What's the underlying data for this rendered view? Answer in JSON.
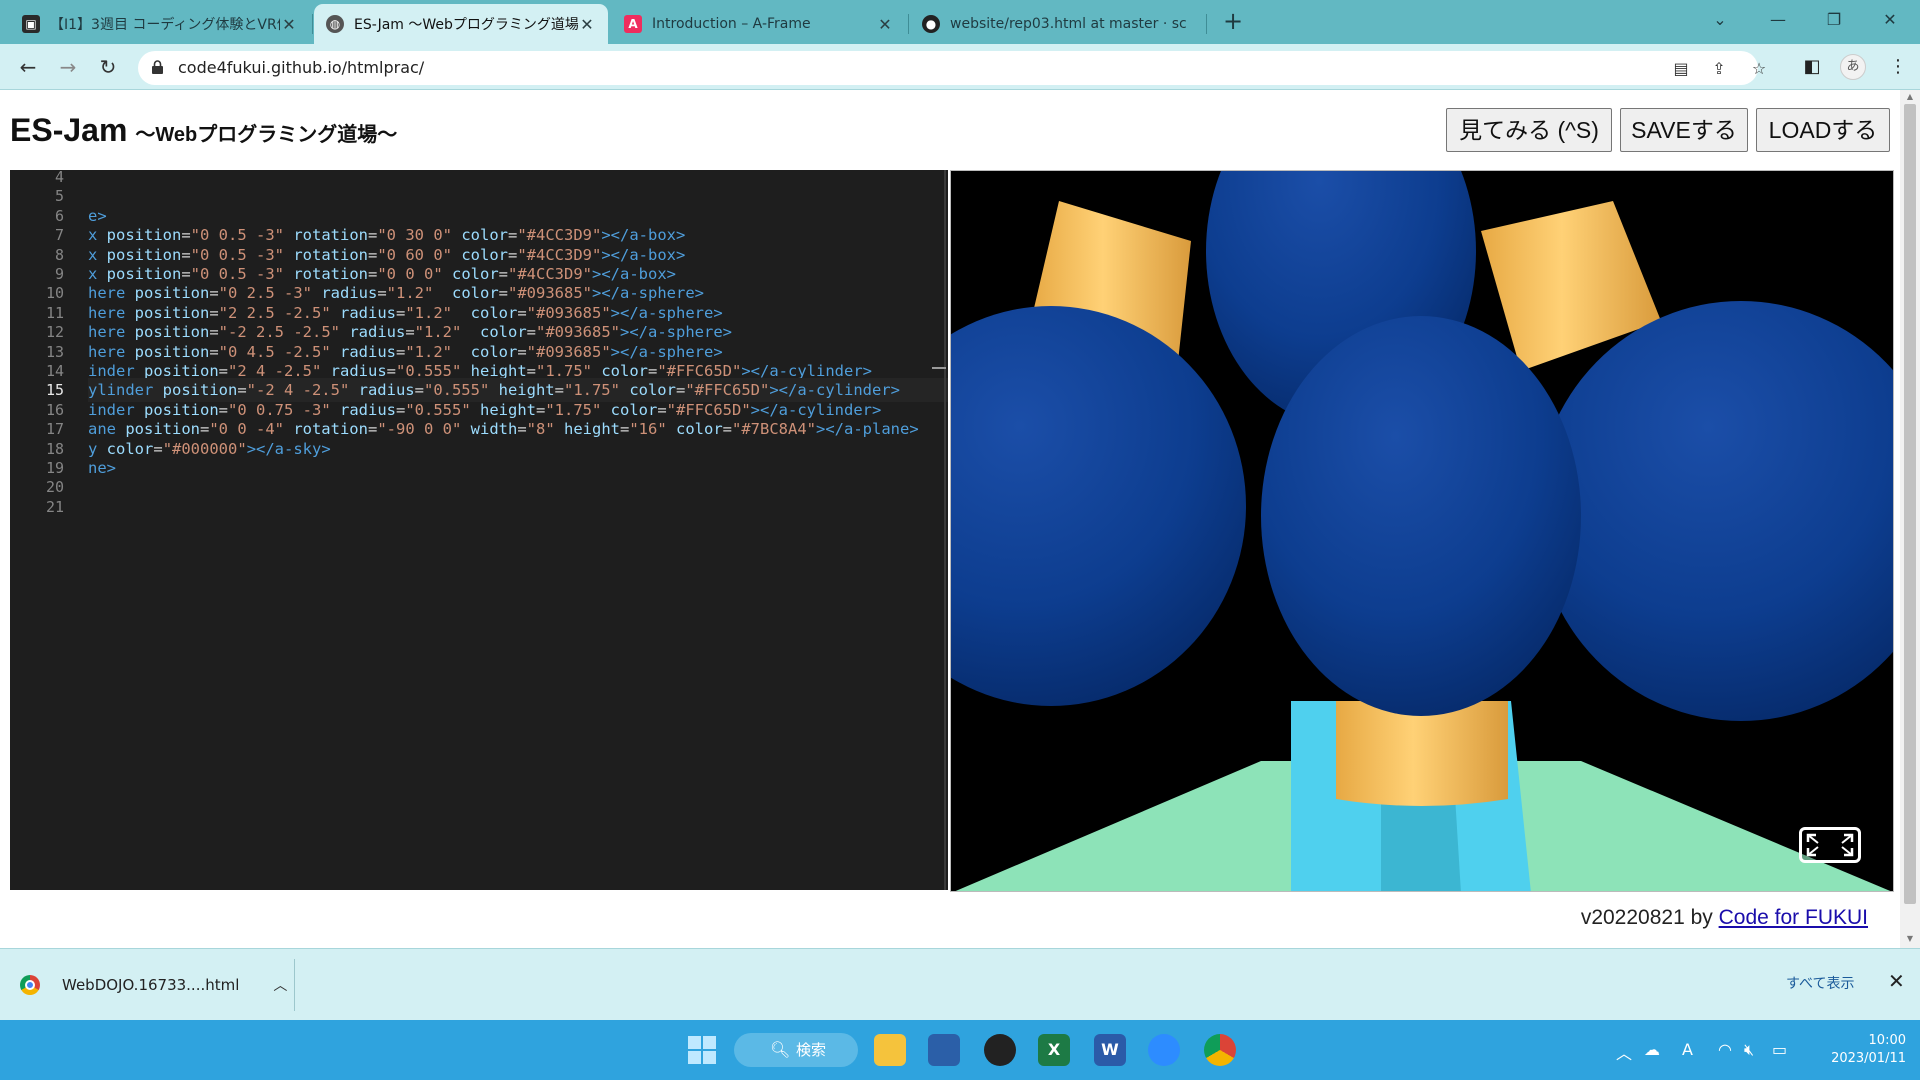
{
  "browser": {
    "tabs": [
      {
        "title": "【I1】3週目 コーディング体験とVR体験",
        "active": false
      },
      {
        "title": "ES-Jam ～Webプログラミング道場～",
        "active": true
      },
      {
        "title": "Introduction – A-Frame",
        "active": false
      },
      {
        "title": "website/rep03.html at master · sc",
        "active": false
      }
    ],
    "url": "code4fukui.github.io/htmlprac/"
  },
  "app": {
    "title": "ES-Jam",
    "subtitle": "～Webプログラミング道場～",
    "buttons": {
      "preview": "見てみる (^S)",
      "save": "SAVEする",
      "load": "LOADする"
    },
    "footer_version": "v20220821 by ",
    "footer_link": "Code for FUKUI"
  },
  "editor": {
    "current_line": 15,
    "lines": [
      {
        "n": 4,
        "tokens": []
      },
      {
        "n": 5,
        "tokens": []
      },
      {
        "n": 6,
        "tokens": [
          [
            "tag",
            "e>"
          ]
        ]
      },
      {
        "n": 7,
        "tokens": [
          [
            "tag",
            "x "
          ],
          [
            "attr",
            "position"
          ],
          [
            "eq",
            "="
          ],
          [
            "str",
            "\"0 0.5 -3\""
          ],
          [
            "attr",
            " rotation"
          ],
          [
            "eq",
            "="
          ],
          [
            "str",
            "\"0 30 0\""
          ],
          [
            "attr",
            " color"
          ],
          [
            "eq",
            "="
          ],
          [
            "str",
            "\"#4CC3D9\""
          ],
          [
            "tag",
            "></a-box>"
          ]
        ]
      },
      {
        "n": 8,
        "tokens": [
          [
            "tag",
            "x "
          ],
          [
            "attr",
            "position"
          ],
          [
            "eq",
            "="
          ],
          [
            "str",
            "\"0 0.5 -3\""
          ],
          [
            "attr",
            " rotation"
          ],
          [
            "eq",
            "="
          ],
          [
            "str",
            "\"0 60 0\""
          ],
          [
            "attr",
            " color"
          ],
          [
            "eq",
            "="
          ],
          [
            "str",
            "\"#4CC3D9\""
          ],
          [
            "tag",
            "></a-box>"
          ]
        ]
      },
      {
        "n": 9,
        "tokens": [
          [
            "tag",
            "x "
          ],
          [
            "attr",
            "position"
          ],
          [
            "eq",
            "="
          ],
          [
            "str",
            "\"0 0.5 -3\""
          ],
          [
            "attr",
            " rotation"
          ],
          [
            "eq",
            "="
          ],
          [
            "str",
            "\"0 0 0\""
          ],
          [
            "attr",
            " color"
          ],
          [
            "eq",
            "="
          ],
          [
            "str",
            "\"#4CC3D9\""
          ],
          [
            "tag",
            "></a-box>"
          ]
        ]
      },
      {
        "n": 10,
        "tokens": [
          [
            "tag",
            "here "
          ],
          [
            "attr",
            "position"
          ],
          [
            "eq",
            "="
          ],
          [
            "str",
            "\"0 2.5 -3\""
          ],
          [
            "attr",
            " radius"
          ],
          [
            "eq",
            "="
          ],
          [
            "str",
            "\"1.2\""
          ],
          [
            "attr",
            "  color"
          ],
          [
            "eq",
            "="
          ],
          [
            "str",
            "\"#093685\""
          ],
          [
            "tag",
            "></a-sphere>"
          ]
        ]
      },
      {
        "n": 11,
        "tokens": [
          [
            "tag",
            "here "
          ],
          [
            "attr",
            "position"
          ],
          [
            "eq",
            "="
          ],
          [
            "str",
            "\"2 2.5 -2.5\""
          ],
          [
            "attr",
            " radius"
          ],
          [
            "eq",
            "="
          ],
          [
            "str",
            "\"1.2\""
          ],
          [
            "attr",
            "  color"
          ],
          [
            "eq",
            "="
          ],
          [
            "str",
            "\"#093685\""
          ],
          [
            "tag",
            "></a-sphere>"
          ]
        ]
      },
      {
        "n": 12,
        "tokens": [
          [
            "tag",
            "here "
          ],
          [
            "attr",
            "position"
          ],
          [
            "eq",
            "="
          ],
          [
            "str",
            "\"-2 2.5 -2.5\""
          ],
          [
            "attr",
            " radius"
          ],
          [
            "eq",
            "="
          ],
          [
            "str",
            "\"1.2\""
          ],
          [
            "attr",
            "  color"
          ],
          [
            "eq",
            "="
          ],
          [
            "str",
            "\"#093685\""
          ],
          [
            "tag",
            "></a-sphere>"
          ]
        ]
      },
      {
        "n": 13,
        "tokens": [
          [
            "tag",
            "here "
          ],
          [
            "attr",
            "position"
          ],
          [
            "eq",
            "="
          ],
          [
            "str",
            "\"0 4.5 -2.5\""
          ],
          [
            "attr",
            " radius"
          ],
          [
            "eq",
            "="
          ],
          [
            "str",
            "\"1.2\""
          ],
          [
            "attr",
            "  color"
          ],
          [
            "eq",
            "="
          ],
          [
            "str",
            "\"#093685\""
          ],
          [
            "tag",
            "></a-sphere>"
          ]
        ]
      },
      {
        "n": 14,
        "tokens": [
          [
            "tag",
            "inder "
          ],
          [
            "attr",
            "position"
          ],
          [
            "eq",
            "="
          ],
          [
            "str",
            "\"2 4 -2.5\""
          ],
          [
            "attr",
            " radius"
          ],
          [
            "eq",
            "="
          ],
          [
            "str",
            "\"0.555\""
          ],
          [
            "attr",
            " height"
          ],
          [
            "eq",
            "="
          ],
          [
            "str",
            "\"1.75\""
          ],
          [
            "attr",
            " color"
          ],
          [
            "eq",
            "="
          ],
          [
            "str",
            "\"#FFC65D\""
          ],
          [
            "tag",
            "></a-cylinder>"
          ]
        ]
      },
      {
        "n": 15,
        "tokens": [
          [
            "tag",
            "ylinder "
          ],
          [
            "attr",
            "position"
          ],
          [
            "eq",
            "="
          ],
          [
            "str",
            "\"-2 4 -2.5\""
          ],
          [
            "attr",
            " radius"
          ],
          [
            "eq",
            "="
          ],
          [
            "str",
            "\"0.555\""
          ],
          [
            "attr",
            " height"
          ],
          [
            "eq",
            "="
          ],
          [
            "str",
            "\"1.75\""
          ],
          [
            "attr",
            " color"
          ],
          [
            "eq",
            "="
          ],
          [
            "str",
            "\"#FFC65D\""
          ],
          [
            "tag",
            "></a-cylinder>"
          ]
        ]
      },
      {
        "n": 16,
        "tokens": [
          [
            "tag",
            "inder "
          ],
          [
            "attr",
            "position"
          ],
          [
            "eq",
            "="
          ],
          [
            "str",
            "\"0 0.75 -3\""
          ],
          [
            "attr",
            " radius"
          ],
          [
            "eq",
            "="
          ],
          [
            "str",
            "\"0.555\""
          ],
          [
            "attr",
            " height"
          ],
          [
            "eq",
            "="
          ],
          [
            "str",
            "\"1.75\""
          ],
          [
            "attr",
            " color"
          ],
          [
            "eq",
            "="
          ],
          [
            "str",
            "\"#FFC65D\""
          ],
          [
            "tag",
            "></a-cylinder>"
          ]
        ]
      },
      {
        "n": 17,
        "tokens": [
          [
            "tag",
            "ane "
          ],
          [
            "attr",
            "position"
          ],
          [
            "eq",
            "="
          ],
          [
            "str",
            "\"0 0 -4\""
          ],
          [
            "attr",
            " rotation"
          ],
          [
            "eq",
            "="
          ],
          [
            "str",
            "\"-90 0 0\""
          ],
          [
            "attr",
            " width"
          ],
          [
            "eq",
            "="
          ],
          [
            "str",
            "\"8\""
          ],
          [
            "attr",
            " height"
          ],
          [
            "eq",
            "="
          ],
          [
            "str",
            "\"16\""
          ],
          [
            "attr",
            " color"
          ],
          [
            "eq",
            "="
          ],
          [
            "str",
            "\"#7BC8A4\""
          ],
          [
            "tag",
            "></a-plane>"
          ]
        ]
      },
      {
        "n": 18,
        "tokens": [
          [
            "tag",
            "y "
          ],
          [
            "attr",
            "color"
          ],
          [
            "eq",
            "="
          ],
          [
            "str",
            "\"#000000\""
          ],
          [
            "tag",
            "></a-sky>"
          ]
        ]
      },
      {
        "n": 19,
        "tokens": [
          [
            "tag",
            "ne>"
          ]
        ]
      },
      {
        "n": 20,
        "tokens": []
      },
      {
        "n": 21,
        "tokens": []
      }
    ]
  },
  "download_bar": {
    "filename": "WebDOJO.16733....html",
    "show_all": "すべて表示"
  },
  "taskbar": {
    "search_label": "検索",
    "time": "10:00",
    "date": "2023/01/11"
  },
  "colors": {
    "sphere": "#093685",
    "cylinder": "#FFC65D",
    "box": "#4CC3D9",
    "plane": "#7BC8A4",
    "sky": "#000000",
    "accent_tab": "#62b8c2"
  }
}
